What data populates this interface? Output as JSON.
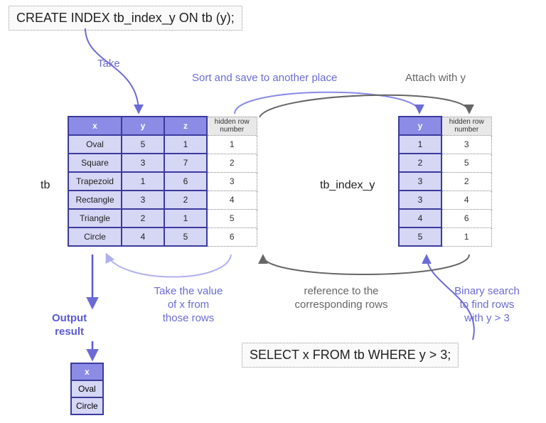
{
  "sql_create": "CREATE INDEX tb_index_y ON tb (y);",
  "sql_select": "SELECT x FROM tb WHERE y > 3;",
  "tb_label": "tb",
  "idx_label": "tb_index_y",
  "tb_headers": {
    "x": "x",
    "y": "y",
    "z": "z",
    "hidden": "hidden row number"
  },
  "tb_rows": [
    {
      "x": "Oval",
      "y": "5",
      "z": "1",
      "h": "1"
    },
    {
      "x": "Square",
      "y": "3",
      "z": "7",
      "h": "2"
    },
    {
      "x": "Trapezoid",
      "y": "1",
      "z": "6",
      "h": "3"
    },
    {
      "x": "Rectangle",
      "y": "3",
      "z": "2",
      "h": "4"
    },
    {
      "x": "Triangle",
      "y": "2",
      "z": "1",
      "h": "5"
    },
    {
      "x": "Circle",
      "y": "4",
      "z": "5",
      "h": "6"
    }
  ],
  "idx_headers": {
    "y": "y",
    "hidden": "hidden row number"
  },
  "idx_rows": [
    {
      "y": "1",
      "h": "3"
    },
    {
      "y": "2",
      "h": "5"
    },
    {
      "y": "3",
      "h": "2"
    },
    {
      "y": "3",
      "h": "4"
    },
    {
      "y": "4",
      "h": "6"
    },
    {
      "y": "5",
      "h": "1"
    }
  ],
  "result_header": "x",
  "result_rows": [
    "Oval",
    "Circle"
  ],
  "ann": {
    "take": "Take",
    "sort": "Sort and save to another place",
    "attach": "Attach with y",
    "take_x1": "Take the value",
    "take_x2": "of x from",
    "take_x3": "those rows",
    "ref1": "reference to the",
    "ref2": "corresponding rows",
    "bin1": "Binary search",
    "bin2": "to find rows",
    "bin3": "with y > 3",
    "out1": "Output",
    "out2": "result"
  },
  "colors": {
    "purple": "#6b6bd6",
    "grey": "#666"
  }
}
